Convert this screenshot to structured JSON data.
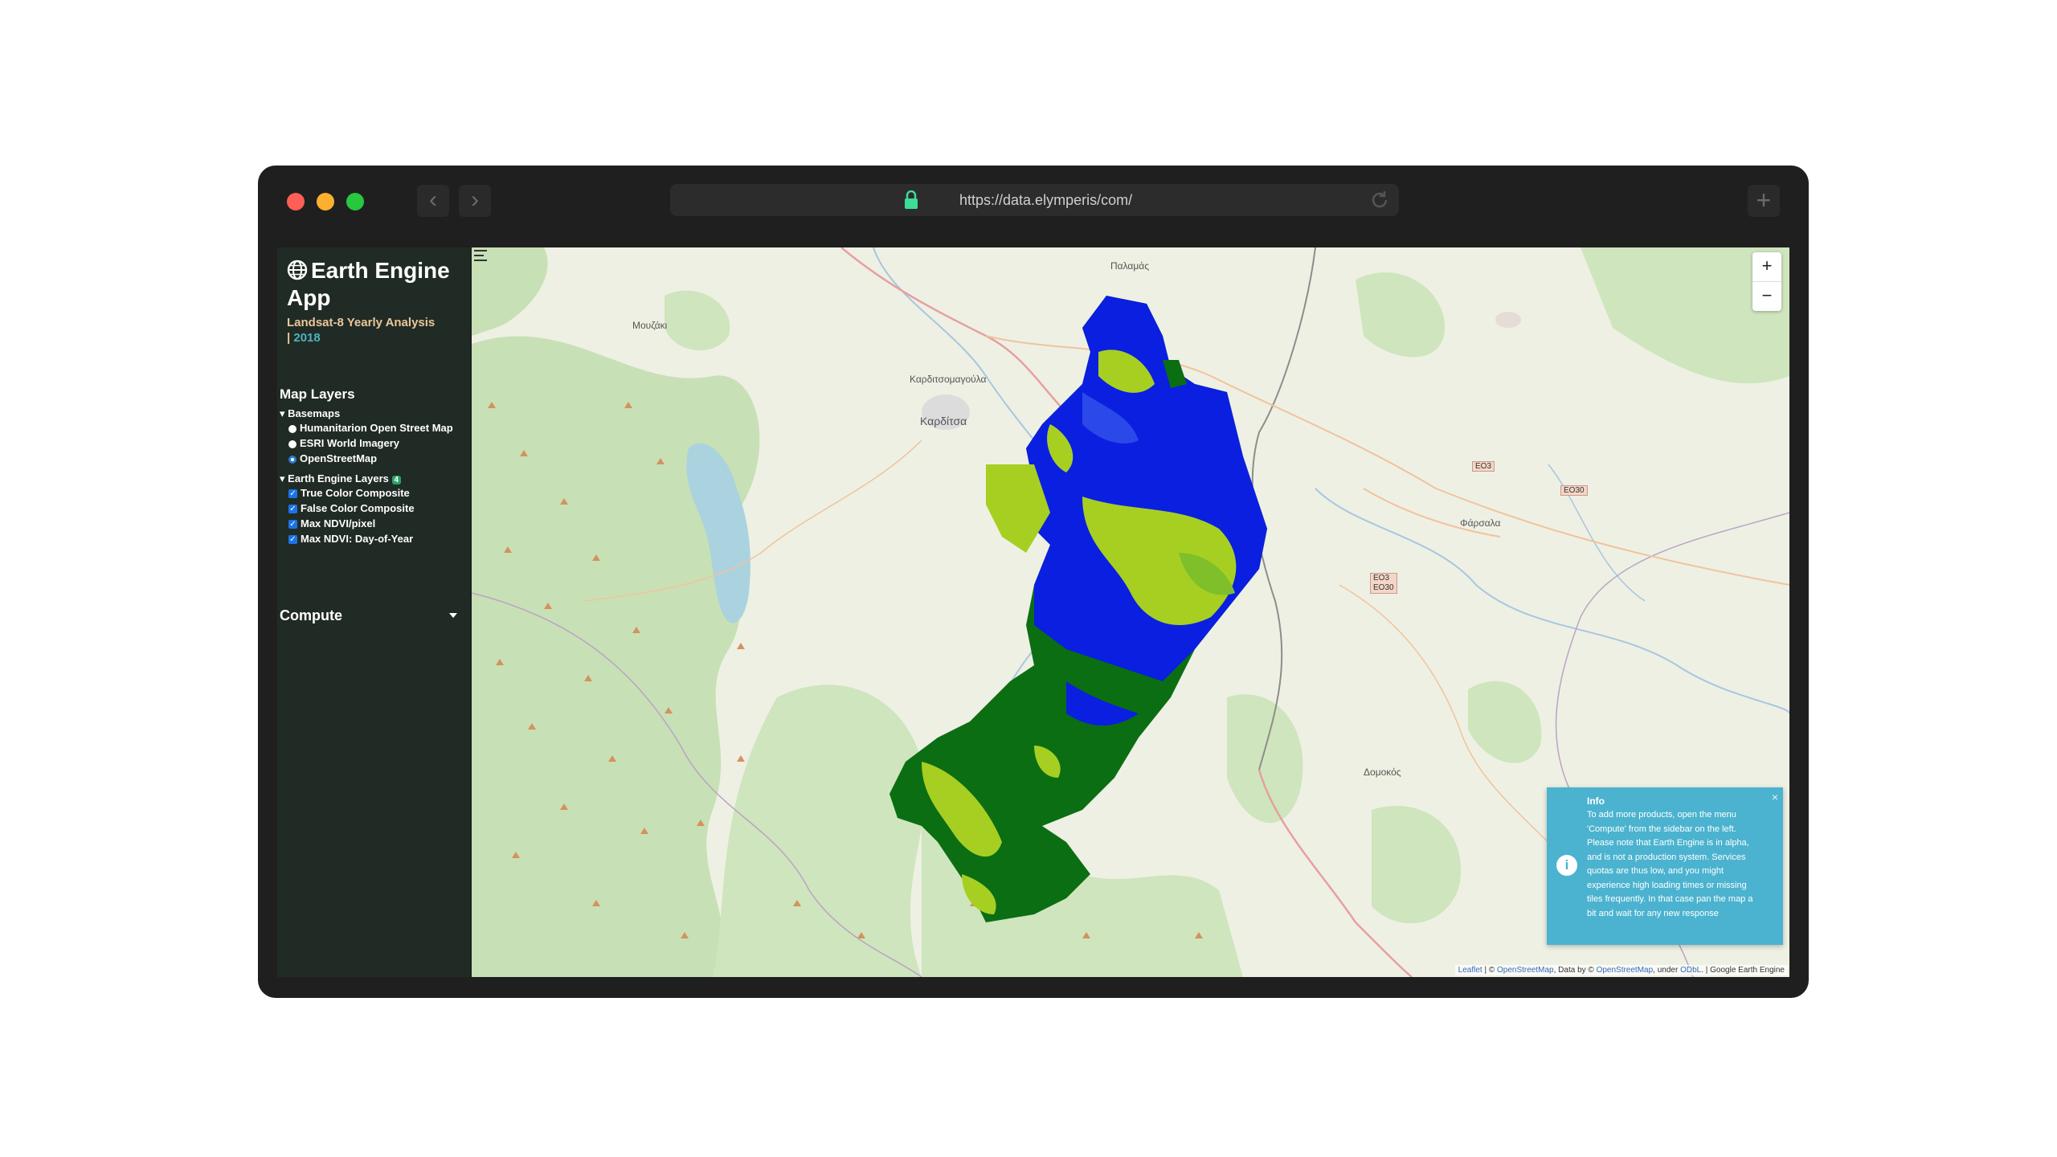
{
  "browser": {
    "url": "https://data.elymperis/com/",
    "back_icon": "chevron-left-icon",
    "forward_icon": "chevron-right-icon",
    "new_tab_label": "+"
  },
  "sidebar": {
    "title": "Earth Engine App",
    "subtitle": "Landsat-8 Yearly Analysis",
    "year_separator": "|",
    "year": "2018",
    "map_layers_title": "Map Layers",
    "basemaps_title": "Basemaps",
    "basemaps": [
      {
        "label": "Humanitarion Open Street Map",
        "selected": false
      },
      {
        "label": "ESRI World Imagery",
        "selected": false
      },
      {
        "label": "OpenStreetMap",
        "selected": true
      }
    ],
    "ee_layers_title": "Earth Engine Layers",
    "ee_layers_count": "4",
    "ee_layers": [
      {
        "label": "True Color Composite",
        "checked": true
      },
      {
        "label": "False Color Composite",
        "checked": true
      },
      {
        "label": "Max NDVI/pixel",
        "checked": true
      },
      {
        "label": "Max NDVI: Day-of-Year",
        "checked": true
      }
    ],
    "compute_label": "Compute"
  },
  "map": {
    "zoom_in": "+",
    "zoom_out": "−",
    "places": {
      "palamas": "Παλαμάς",
      "karditsomagoula": "Καρδιτσομαγούλα",
      "karditsa": "Καρδίτσα",
      "mouzaki": "Μουζάκι",
      "farsala": "Φάρσαλα",
      "domokos": "Δομοκός"
    },
    "roads": {
      "eo3_a": "ΕΟ3",
      "eo30": "ΕΟ30",
      "eo3_b": "ΕΟ3\nΕΟ30"
    },
    "attribution": {
      "leaflet": "Leaflet",
      "sep": " | © ",
      "osm": "OpenStreetMap",
      "data_by": ", Data by © ",
      "osm2": "OpenStreetMap",
      "under": ", under ",
      "odbl": "ODbL",
      "tail": ". | Google Earth Engine"
    },
    "colors": {
      "blue_layer": "#0a1fe0",
      "lime_layer": "#a6cf22",
      "dark_green_layer": "#0b6e13",
      "forest": "#c5dfb3",
      "water": "#aad3df"
    }
  },
  "info": {
    "title": "Info",
    "text": "To add more products, open the menu 'Compute' from the sidebar on the left. Please note that Earth Engine is in alpha, and is not a production system. Services quotas are thus low, and you might experience high loading times or missing tiles frequently. In that case pan the map a bit and wait for any new response",
    "close": "×",
    "icon": "info-icon"
  }
}
